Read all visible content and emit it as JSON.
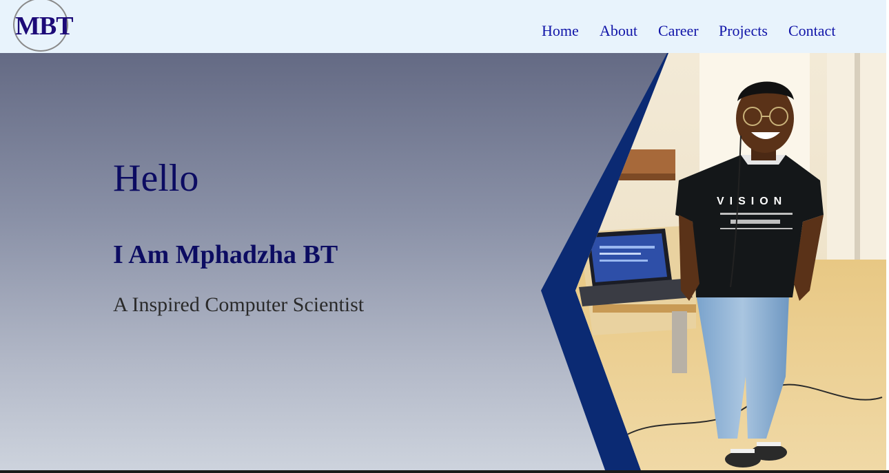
{
  "logo": {
    "text": "MBT"
  },
  "nav": {
    "home": "Home",
    "about": "About",
    "career": "Career",
    "projects": "Projects",
    "contact": "Contact"
  },
  "hero": {
    "greeting": "Hello",
    "name": "I Am Mphadzha BT",
    "tagline": "A Inspired Computer Scientist",
    "photo_subject": "portrait-photo",
    "shirt_text": "VISION"
  },
  "colors": {
    "nav_bg": "#e8f3fc",
    "nav_link": "#1014a8",
    "heading": "#0c0c62",
    "accent_navy": "#0b2a73"
  }
}
